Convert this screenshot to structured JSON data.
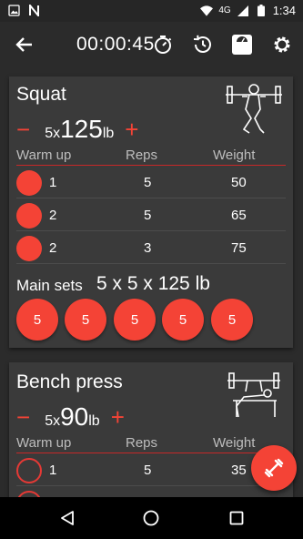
{
  "status_bar": {
    "time": "1:34",
    "network": "4G",
    "icons": [
      "photo-icon",
      "n-notification-icon",
      "wifi-icon",
      "signal-icon",
      "battery-icon"
    ]
  },
  "app_bar": {
    "timer": "00:00:45",
    "icons": [
      "back-arrow-icon",
      "stopwatch-icon",
      "history-icon",
      "scale-icon",
      "gear-icon"
    ]
  },
  "exercises": [
    {
      "name": "Squat",
      "minus": "−",
      "plus": "+",
      "sets_x": "5x",
      "weight": "125",
      "unit": "lb",
      "headers": {
        "warmup": "Warm up",
        "reps": "Reps",
        "weight": "Weight"
      },
      "warmup_rows": [
        {
          "set": "1",
          "reps": "5",
          "weight": "50",
          "done": true
        },
        {
          "set": "2",
          "reps": "5",
          "weight": "65",
          "done": true
        },
        {
          "set": "2",
          "reps": "3",
          "weight": "75",
          "done": true
        }
      ],
      "main_label": "Main sets",
      "main_value": "5 x 5 x 125 lb",
      "main_sets": [
        "5",
        "5",
        "5",
        "5",
        "5"
      ]
    },
    {
      "name": "Bench press",
      "minus": "−",
      "plus": "+",
      "sets_x": "5x",
      "weight": "90",
      "unit": "lb",
      "headers": {
        "warmup": "Warm up",
        "reps": "Reps",
        "weight": "Weight"
      },
      "warmup_rows": [
        {
          "set": "1",
          "reps": "5",
          "weight": "35",
          "done": false
        }
      ]
    }
  ],
  "colors": {
    "accent": "#f44336",
    "background": "#2b2b2b",
    "card": "#3a3a3a"
  }
}
